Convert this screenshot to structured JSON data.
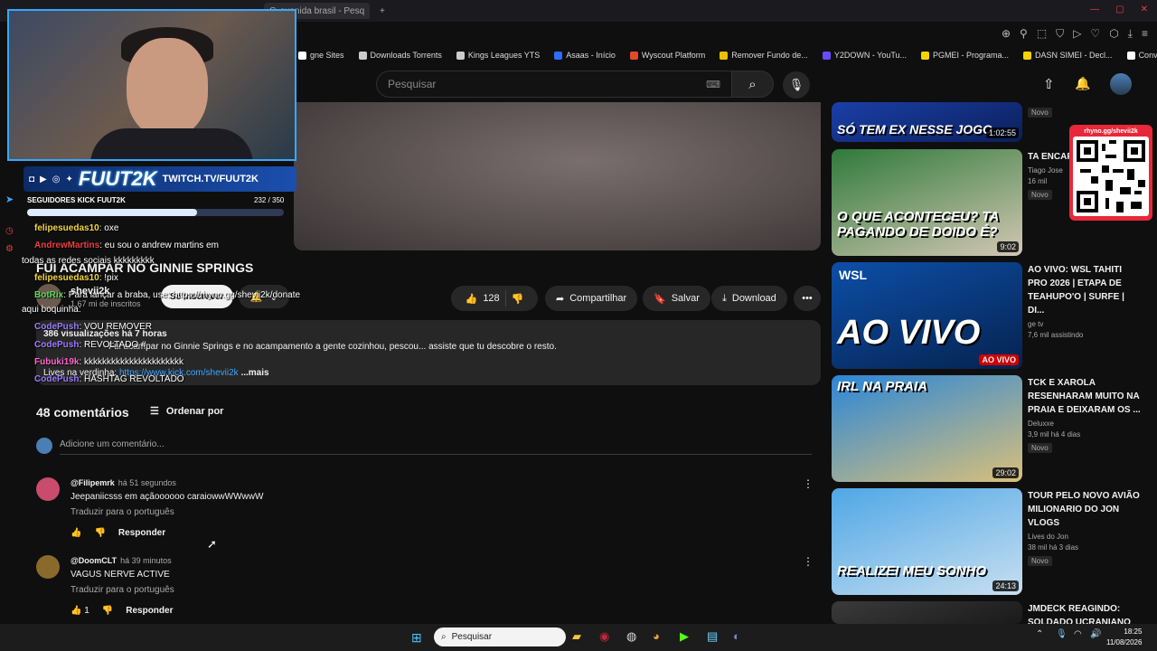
{
  "browser": {
    "tabs": [
      {
        "label": "avenida brasil - Pesq",
        "active": true
      }
    ],
    "new_tab": "+",
    "bookmarks": [
      {
        "label": "gne Sites",
        "color": "#ffffff"
      },
      {
        "label": "Downloads Torrents",
        "color": "#cccccc"
      },
      {
        "label": "Kings Leagues YTS",
        "color": "#cccccc"
      },
      {
        "label": "Asaas - Início",
        "color": "#2d6cff"
      },
      {
        "label": "Wyscout Platform",
        "color": "#e24b2a"
      },
      {
        "label": "Remover Fundo de...",
        "color": "#f0c000"
      },
      {
        "label": "Y2DOWN - YouTu...",
        "color": "#6a4bff"
      },
      {
        "label": "PGMEI - Programa...",
        "color": "#f7d400"
      },
      {
        "label": "DASN SIMEI - Decl...",
        "color": "#f7d400"
      },
      {
        "label": "Conversor de You...",
        "color": "#ffffff"
      }
    ]
  },
  "youtube": {
    "search_placeholder": "Pesquisar",
    "video_title": "FUI ACAMPAR NO GINNIE SPRINGS",
    "channel": {
      "name": "shevii2k",
      "subscribers": "1,67 mi de inscritos",
      "subscribed_label": "Se inscrever"
    },
    "actions": {
      "likes": "128",
      "share": "Compartilhar",
      "save": "Salvar",
      "download": "Download",
      "more": "•••"
    },
    "description": {
      "stats": "386 visualizações  há 7 horas",
      "text": "Fui acampar no Ginnie Springs e no acampamento a gente cozinhou, pescou... assiste que tu descobre o resto.",
      "link_prefix": "Lives na verdinha:",
      "link": "https://www.kick.com/shevii2k",
      "more": "...mais"
    },
    "comments_header": {
      "count": "48 comentários",
      "sort": "Ordenar por",
      "add_placeholder": "Adicione um comentário..."
    },
    "comments": [
      {
        "author": "@Filipemrk",
        "time": "há 51 segundos",
        "text": "Jeepaniicsss em açãoooooo caraiowwWWwwW",
        "translate": "Traduzir para o português",
        "likes": "",
        "reply": "Responder",
        "avatar_color": "#c94b6d"
      },
      {
        "author": "@DoomCLT",
        "time": "há 39 minutos",
        "text": "VAGUS NERVE ACTIVE",
        "translate": "Traduzir para o português",
        "likes": "1",
        "reply": "Responder",
        "avatar_color": "#8a6a2a"
      }
    ],
    "recommendations": [
      {
        "title": "",
        "channel": "",
        "meta": "",
        "badge": "Novo",
        "duration": "1:02:55",
        "thumb_text": "SÓ TEM EX NESSE JOGO",
        "thumb_colors": [
          "#1a3fa8",
          "#0b1f5a"
        ]
      },
      {
        "title": "TA ENCAR ?",
        "channel": "Tiago Jose",
        "meta": "16 mil",
        "badge": "Novo",
        "duration": "9:02",
        "thumb_text": "O QUE ACONTECEU?  TA PAGANDO DE DOIDO É?",
        "thumb_colors": [
          "#2f7a3a",
          "#d3c7b4"
        ]
      },
      {
        "title": "AO VIVO: WSL TAHITI PRO 2026 | ETAPA DE TEAHUPO'O | SURFE | DI...",
        "channel": "ge tv",
        "meta": "7,6 mil assistindo",
        "badge": "",
        "duration": "AO VIVO",
        "thumb_text": "AO VIVO",
        "thumb_colors": [
          "#0c4fa8",
          "#06224f"
        ],
        "thumb_top": "WSL"
      },
      {
        "title": "TCK E XAROLA RESENHARAM MUITO NA PRAIA E DEIXARAM OS ...",
        "channel": "Deluxxe",
        "meta": "3,9 mil   há 4 dias",
        "badge": "Novo",
        "duration": "29:02",
        "thumb_text": "IRL NA PRAIA",
        "thumb_colors": [
          "#2a86d8",
          "#d9c07a"
        ]
      },
      {
        "title": "TOUR PELO NOVO AVIÃO MILIONARIO DO JON VLOGS",
        "channel": "Lives do Jon",
        "meta": "38 mil   há 3 dias",
        "badge": "Novo",
        "duration": "24:13",
        "thumb_text": "REALIZEI MEU SONHO",
        "thumb_colors": [
          "#4fa7e6",
          "#c7dff0"
        ]
      },
      {
        "title": "JMDECK REAGINDO: SOLDADO UCRANIANO",
        "channel": "",
        "meta": "",
        "badge": "",
        "duration": "",
        "thumb_text": "",
        "thumb_colors": [
          "#3a3a3a",
          "#1a1a1a"
        ]
      }
    ]
  },
  "overlay": {
    "brand": "FUUT2K",
    "brand_url": "TWITCH.TV/FUUT2K",
    "kick_label": "SEGUIDORES KICK FUUT2K",
    "kick_count": "232 / 350",
    "kick_progress": 0.663,
    "qr_label": "rhyno.gg/shevii2k",
    "chat": [
      {
        "user": "felipesuedas10",
        "msg": ": oxe",
        "color": "#f5d442"
      },
      {
        "user": "AndrewMartins",
        "msg": ": eu sou o andrew martins em",
        "color": "#e84040"
      },
      {
        "user": "",
        "msg": "todas as redes sociais kkkkkkkkk",
        "color": "#ffffff"
      },
      {
        "user": "felipesuedas10",
        "msg": ": !pix",
        "color": "#f5d442"
      },
      {
        "user": "BotRix",
        "msg": ": Para lançar a braba, use: https://rhyno.gg/shevii2k/donate",
        "color": "#5bd65b"
      },
      {
        "user": "",
        "msg": "aqui boquinha:",
        "color": "#ffffff"
      },
      {
        "user": "CodePush",
        "msg": ": VOU REMOVER",
        "color": "#9b7dff"
      },
      {
        "user": "CodePush",
        "msg": ": REVOLTADO #",
        "color": "#9b7dff"
      },
      {
        "user": "Fubuki19k",
        "msg": ": kkkkkkkkkkkkkkkkkkkkkk",
        "color": "#ff66cc"
      },
      {
        "user": "CodePush",
        "msg": ": HASHTAG REVOLTADO",
        "color": "#9b7dff"
      }
    ]
  },
  "taskbar": {
    "search": "Pesquisar",
    "time": "18:25",
    "date": "11/08/2026"
  }
}
